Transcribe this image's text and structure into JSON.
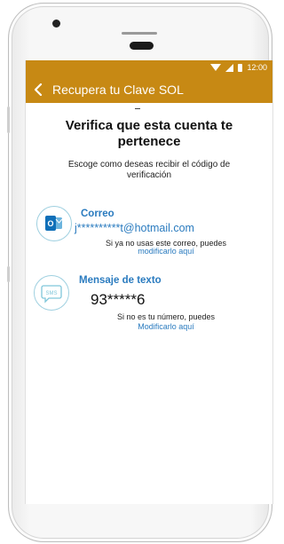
{
  "status_bar": {
    "time": "12:00"
  },
  "app_bar": {
    "title": "Recupera tu Clave SOL",
    "back_icon": "chevron-left-icon"
  },
  "page": {
    "heading_line1": "Verifica que esta cuenta te",
    "heading_line2": "pertenece",
    "subheading_line1": "Escoge como deseas recibir el código de",
    "subheading_line2": "verificación"
  },
  "options": {
    "email": {
      "icon": "outlook-icon",
      "icon_text": "O",
      "title": "Correo",
      "value": "j**********t@hotmail.com",
      "note": "Si ya no usas este correo, puedes",
      "link": "modificarlo aquí"
    },
    "sms": {
      "icon": "sms-icon",
      "icon_text": "SMS",
      "title": "Mensaje de texto",
      "value": "93*****6",
      "note": "Si no es tu número, puedes",
      "link": "Modificarlo aquí"
    }
  },
  "colors": {
    "brand": "#c78914",
    "link": "#2a7bbf",
    "icon_ring": "#9fd0e0"
  }
}
